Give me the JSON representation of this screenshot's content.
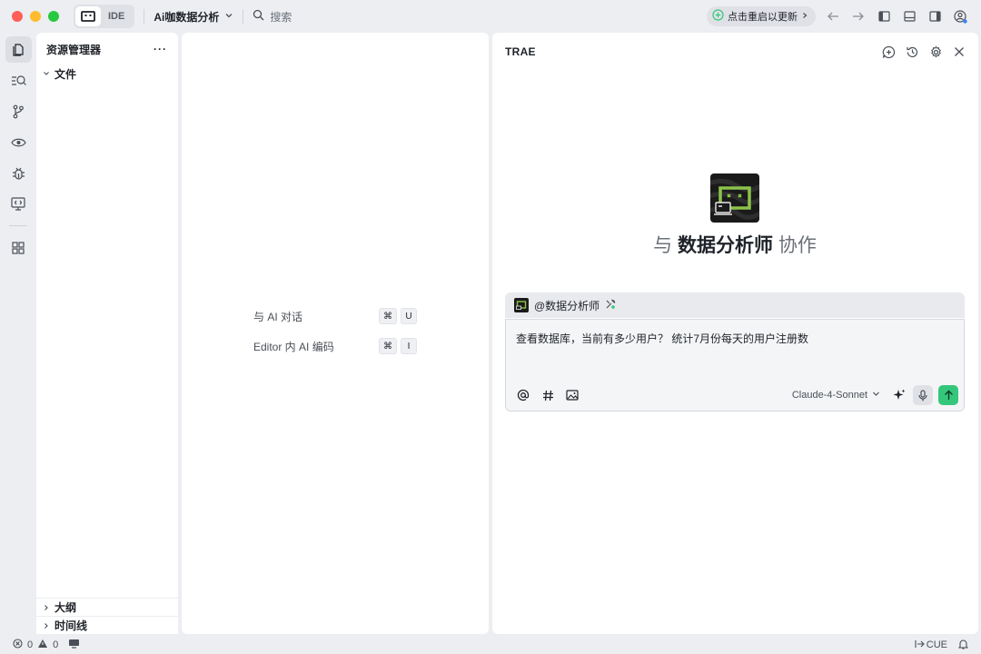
{
  "titlebar": {
    "mode_label": "IDE",
    "project_name": "Ai咖数据分析",
    "search_label": "搜索",
    "update_label": "点击重启以更新"
  },
  "explorer": {
    "title": "资源管理器",
    "more": "···",
    "root_folder": "文件",
    "bottom_sections": [
      "大纲",
      "时间线"
    ]
  },
  "editor": {
    "shortcuts": [
      {
        "label": "与 AI 对话",
        "keys": [
          "⌘",
          "U"
        ]
      },
      {
        "label": "Editor 内 AI 编码",
        "keys": [
          "⌘",
          "I"
        ]
      }
    ]
  },
  "chat": {
    "title": "TRAE",
    "hero_prefix": "与",
    "hero_agent": "数据分析师",
    "hero_suffix": "协作",
    "agent_mention": "@数据分析师",
    "input_text": "查看数据库，当前有多少用户？ 统计7月份每天的用户注册数",
    "model": "Claude-4-Sonnet"
  },
  "status": {
    "errors": "0",
    "warnings": "0",
    "cue": "CUE"
  },
  "colors": {
    "accent_green": "#34c77b",
    "logo_green": "#8bc34a"
  }
}
